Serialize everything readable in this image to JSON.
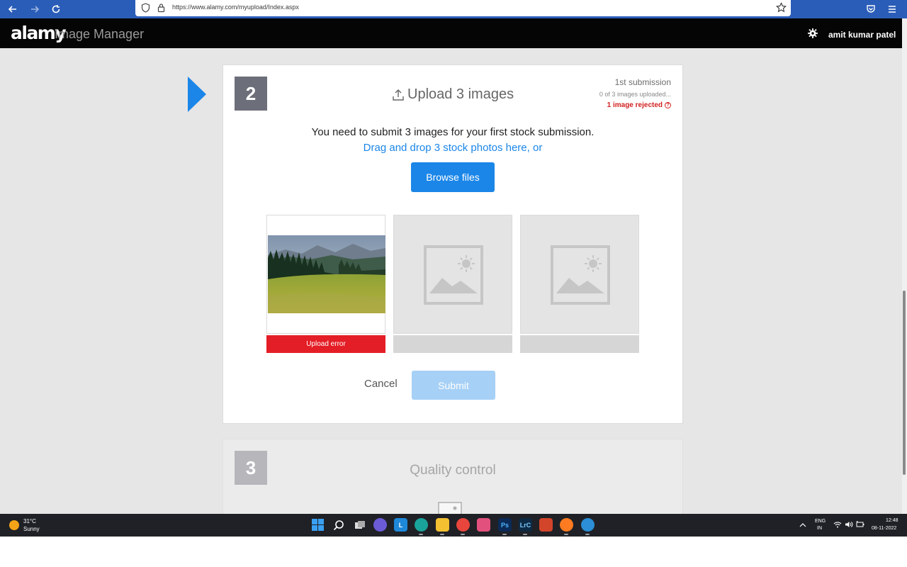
{
  "browser": {
    "url": "https://www.alamy.com/myupload/Index.aspx"
  },
  "header": {
    "logo": "alamy",
    "app_name": "Image Manager",
    "user_name": "amit kumar patel"
  },
  "upload_step": {
    "number": "2",
    "title": "Upload 3 images",
    "submission_label": "1st submission",
    "progress_text": "0 of 3 images uploaded...",
    "rejected_text": "1 image rejected",
    "help_glyph": "?",
    "instruction": "You need to submit 3 images for your first stock submission.",
    "drag_text": "Drag and drop 3 stock photos here, or",
    "browse_label": "Browse files",
    "slots": [
      {
        "status": "Upload error",
        "state": "error",
        "has_image": true
      },
      {
        "status": "",
        "state": "empty",
        "has_image": false
      },
      {
        "status": "",
        "state": "empty",
        "has_image": false
      }
    ],
    "cancel_label": "Cancel",
    "submit_label": "Submit"
  },
  "quality_step": {
    "number": "3",
    "title": "Quality control"
  },
  "taskbar": {
    "temperature": "31°C",
    "weather": "Sunny",
    "language": "ENG",
    "region": "IN",
    "time": "12:48",
    "date": "08-11-2022",
    "apps": [
      {
        "name": "windows-start-icon",
        "glyph": ""
      },
      {
        "name": "search-icon",
        "glyph": ""
      },
      {
        "name": "task-view-icon",
        "glyph": ""
      },
      {
        "name": "chat-icon",
        "glyph": ""
      },
      {
        "name": "lightroom-l-app-icon",
        "glyph": "L"
      },
      {
        "name": "edge-browser-icon",
        "glyph": ""
      },
      {
        "name": "file-explorer-icon",
        "glyph": ""
      },
      {
        "name": "chrome-icon",
        "glyph": ""
      },
      {
        "name": "photos-app-icon",
        "glyph": ""
      },
      {
        "name": "photoshop-icon",
        "glyph": "Ps"
      },
      {
        "name": "lightroom-classic-icon",
        "glyph": "LrC"
      },
      {
        "name": "settings-app-icon",
        "glyph": ""
      },
      {
        "name": "firefox-icon",
        "glyph": ""
      },
      {
        "name": "earth-app-icon",
        "glyph": ""
      }
    ]
  },
  "colors": {
    "accent": "#1b86e8",
    "error": "#e41e26",
    "header_bg": "#050505",
    "browser_bar": "#2a5db8"
  }
}
